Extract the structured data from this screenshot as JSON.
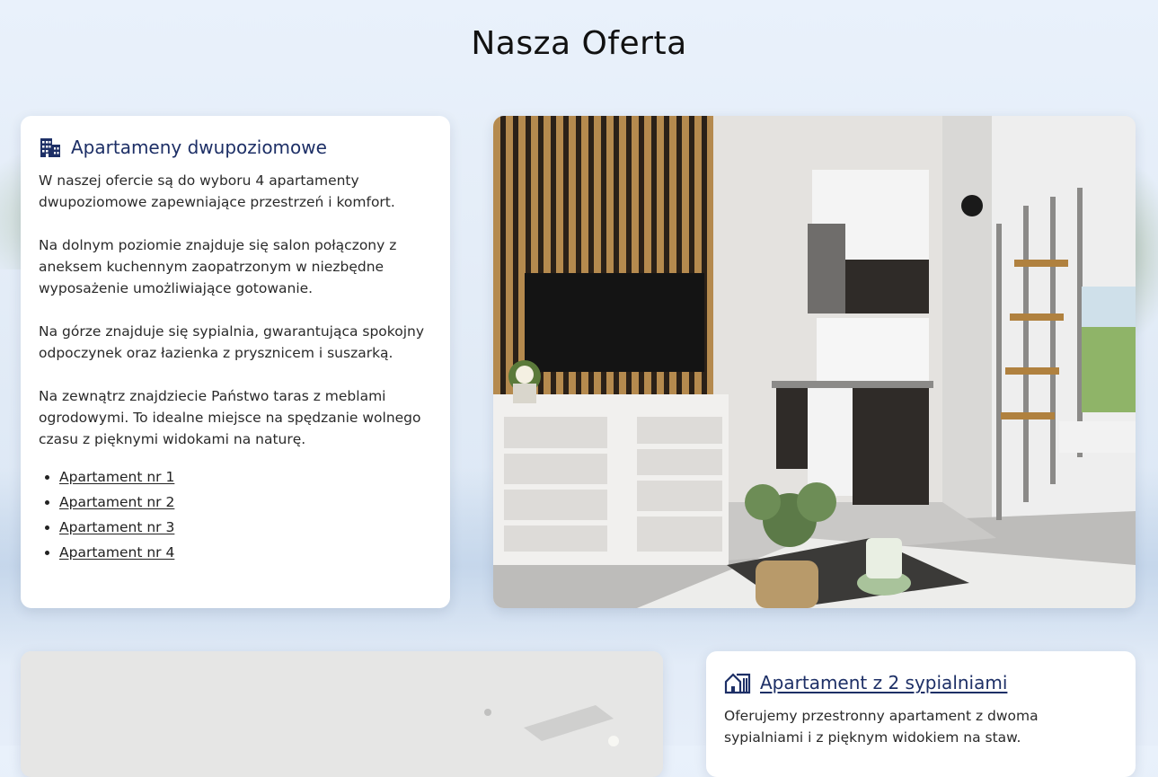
{
  "page": {
    "title": "Nasza Oferta"
  },
  "offer1": {
    "icon": "building-icon",
    "title": "Apartameny dwupoziomowe",
    "paragraphs": [
      "W naszej ofercie są do wyboru 4 apartamenty dwupoziomowe zapewniające przestrzeń i komfort.",
      "Na dolnym poziomie znajduje się salon połączony z aneksem kuchennym zaopatrzonym w niezbędne wyposażenie umożliwiające gotowanie.",
      "Na górze znajduje się sypialnia, gwarantująca spokojny odpoczynek oraz łazienka z prysznicem i suszarką.",
      "Na zewnątrz znajdziecie Państwo taras z meblami ogrodowymi. To idealne miejsce na spędzanie wolnego czasu z pięknymi widokami na naturę."
    ],
    "links": [
      "Apartament nr 1",
      "Apartament nr 2",
      "Apartament nr 3",
      "Apartament nr 4"
    ]
  },
  "offer2": {
    "icon": "house-icon",
    "title": "Apartament z 2 sypialniami",
    "paragraph": "Oferujemy przestronny apartament z dwoma sypialniami i z pięknym widokiem na staw."
  },
  "colors": {
    "accent": "#1d2f66"
  }
}
